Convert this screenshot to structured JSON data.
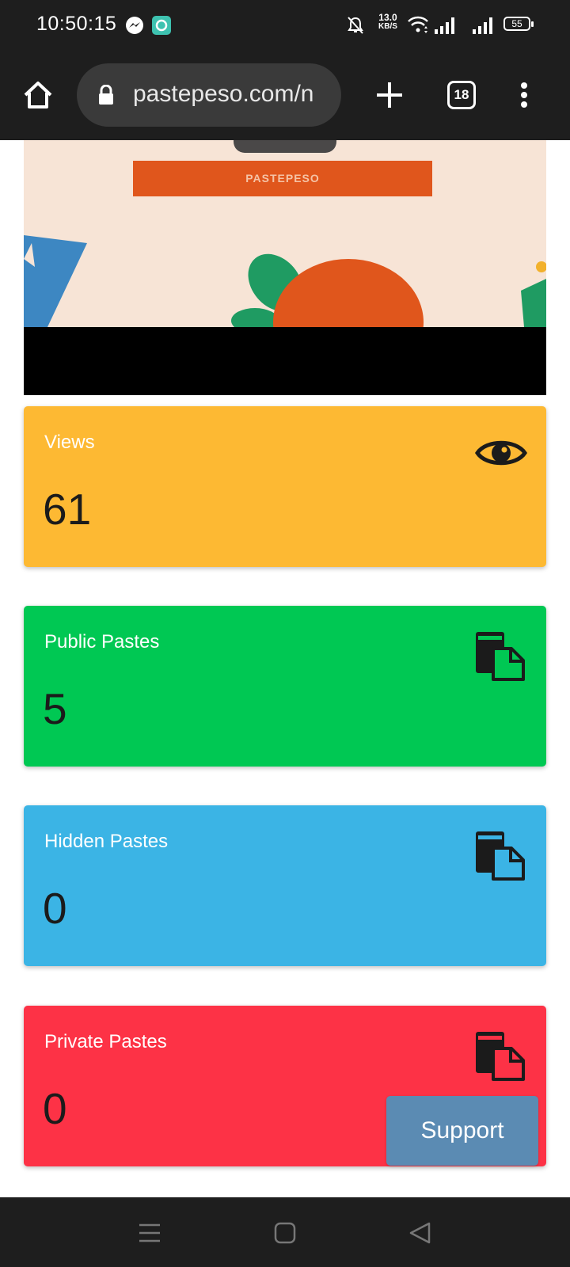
{
  "status_bar": {
    "time": "10:50:15",
    "net_speed_value": "13.0",
    "net_speed_unit": "KB/S",
    "battery": "55",
    "icons": [
      "messenger-icon",
      "app-notification-icon",
      "mute-icon",
      "wifi-icon",
      "signal-icon",
      "signal-icon"
    ]
  },
  "browser": {
    "url": "pastepeso.com/n",
    "tab_count": "18",
    "icons": [
      "home-icon",
      "lock-icon",
      "plus-icon",
      "menu-icon"
    ]
  },
  "hero": {
    "banner_text": "PASTEPESO"
  },
  "cards": [
    {
      "label": "Views",
      "value": "61",
      "color": "#fdb933",
      "icon": "eye-icon"
    },
    {
      "label": "Public Pastes",
      "value": "5",
      "color": "#00c853",
      "icon": "copy-icon"
    },
    {
      "label": "Hidden Pastes",
      "value": "0",
      "color": "#3bb4e5",
      "icon": "copy-icon"
    },
    {
      "label": "Private Pastes",
      "value": "0",
      "color": "#fd3246",
      "icon": "copy-icon"
    }
  ],
  "support_button": {
    "label": "Support"
  },
  "nav_bar": {
    "icons": [
      "recents-icon",
      "home-square-icon",
      "back-icon"
    ]
  }
}
